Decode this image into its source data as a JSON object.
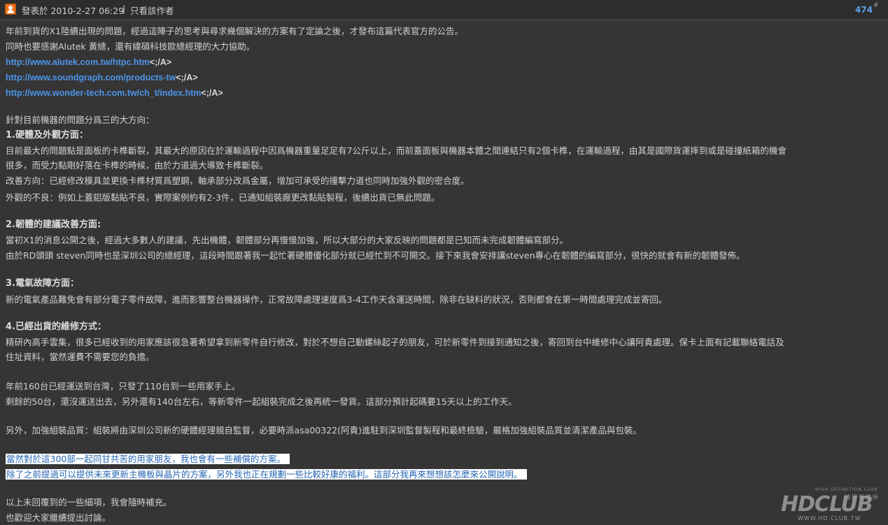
{
  "header": {
    "post_time": "發表於 2010-2-27 06:29",
    "separator": "|",
    "author_only": "只看該作者",
    "floor": "474",
    "floor_mark": "#"
  },
  "post": {
    "intro": "年前到貨的X1陸續出現的問題，經過這陣子的思考與尋求幾個解決的方案有了定論之後，才發布這篇代表官方的公告。",
    "thanks": "同時也要感謝Alutek 黃總，還有緯碩科技歐總經理的大力協助。",
    "links": [
      {
        "url": "http://www.alutek.com.tw/htpc.htm",
        "tag": "<;/A>"
      },
      {
        "url": "http://www.soundgraph.com/products-tw",
        "tag": "<;/A>"
      },
      {
        "url": "http://www.wonder-tech.com.tw/ch_t/index.htm",
        "tag": "<;/A>"
      }
    ],
    "directions": "針對目前機器的問題分爲三的大方向：",
    "s1_title": "1.硬體及外觀方面：",
    "s1_l1": "目前最大的問題點是面板的卡榫斷裂，其最大的原因在於運輸過程中因爲機器重量足足有7公斤以上，而前蓋面板與機器本體之間連結只有2個卡榫，在運輸過程，由其是國際貨運摔到或是碰撞紙箱的機會",
    "s1_l2": "很多，而受力點剛好落在卡榫的時候，由於力道過大導致卡榫斷裂。",
    "s1_l3": "改善方向：已經修改模具並更換卡榫材質爲塑鋼，軸承部分改爲金屬，增加可承受的撞擊力道也同時加強外觀的密合度。",
    "s1_l4": "外觀的不良：例如上蓋鋁版黏貼不良，實際案例約有2-3件，已通知組裝廠更改黏貼製程，後續出貨已無此問題。",
    "s2_title": "2.韌體的建議改善方面:",
    "s2_l1": "當初X1的消息公開之後，經過大多數人的建議，先出機體，韌體部分再慢慢加強，所以大部分的大家反映的問題都是已知而未完成韌體編寫部分。",
    "s2_l2": "由於RD頭頭 steven同時也是深圳公司的總經理，這段時間跟著我一起忙著硬體優化部分就已經忙到不可開交。接下來我會安排讓steven專心在韌體的編寫部分，很快的就會有新的韌體發佈。",
    "s3_title": "3.電氣故障方面：",
    "s3_l1": "新的電氣產品難免會有部分電子零件故障，進而影響整台機器操作，正常故障處理速度爲3-4工作天含運送時間，除非在缺料的狀況，否則都會在第一時間處理完成並寄回。",
    "s4_title": "4.已經出貨的維修方式：",
    "s4_l1": "精研內高手雲集，很多已經收到的用家應該很急著希望拿到新零件自行修改，對於不想自己動螺絲起子的朋友，可於新零件到接到通知之後，寄回到台中維修中心讓阿貴處理。保卡上面有記載聯絡電話及",
    "s4_l2": "住址資料，當然運費不需要您的負擔。",
    "ship_l1": "年前160台已經運送到台灣，只發了110台到一些用家手上。",
    "ship_l2": "剩餘的50台，還沒運送出去，另外還有140台左右，等新零件一起組裝完成之後再統一發貨。這部分預計起碼要15天以上的工作天。",
    "qa": "另外，加強組裝品質：組裝將由深圳公司新的硬體經理親自監督，必要時派asa00322(阿貴)進駐到深圳監督製程和最終檢驗，嚴格加強組裝品質並清潔產品與包裝。",
    "hl1": "當然對於這300部一起同甘共苦的用家朋友，我也會有一些補償的方案。",
    "hl2": "除了之前提過可以提供未來更新主機板與晶片的方案，另外我也正在規劃一些比較好康的福利。這部分我再來想想該怎麼來公開說明。",
    "closing_l1": "以上未回覆到的一些細項，我會隨時補充。",
    "closing_l2": "也歡迎大家繼續提出討論。"
  },
  "watermark": {
    "small": "HIGH DEFINITION CLUB",
    "main": "HDCLUB",
    "sub": "精研視務所",
    "url": "WWW.HD.CLUB.TW"
  }
}
